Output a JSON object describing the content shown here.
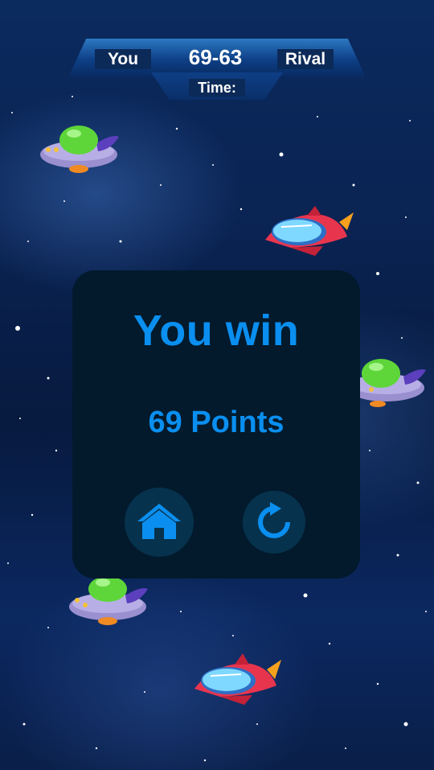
{
  "hud": {
    "player_label": "You",
    "score": "69-63",
    "opponent_label": "Rival",
    "timer_label": "Time:"
  },
  "result_dialog": {
    "title": "You win",
    "points_text": "69 Points",
    "buttons": [
      {
        "name": "home",
        "icon": "home-icon"
      },
      {
        "name": "restart",
        "icon": "restart-icon"
      }
    ]
  },
  "colors": {
    "accent": "#0a8ff0",
    "dialog_bg": "#021a2c",
    "button_bg": "#07324d",
    "hud_blue": "#1b5aa8"
  },
  "sprites": [
    "ufo-green-dome",
    "red-rocket-ship"
  ]
}
